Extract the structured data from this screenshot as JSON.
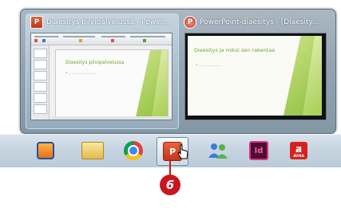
{
  "thumbnails": [
    {
      "title": "Diaesitys pilvipalvelussa - Power...",
      "icon": "powerpoint-icon",
      "slide_title": "Diaesitys pilvipalvelussa",
      "active": true
    },
    {
      "title": "PowerPoint-diaesitys - [Diaesity...",
      "icon": "powerpoint-web-icon",
      "slide_title": "Diaesitys ja miksi sen rakentaa",
      "active": false
    }
  ],
  "taskbar": {
    "items": [
      {
        "name": "media-player",
        "icon": "media-player-icon"
      },
      {
        "name": "file-explorer",
        "icon": "folder-icon"
      },
      {
        "name": "chrome",
        "icon": "chrome-icon"
      },
      {
        "name": "powerpoint",
        "icon": "powerpoint-icon",
        "glyph": "P"
      },
      {
        "name": "people",
        "icon": "people-icon"
      },
      {
        "name": "indesign",
        "icon": "indesign-icon",
        "glyph": "Id"
      },
      {
        "name": "avira",
        "icon": "avira-icon",
        "glyph": "AVIRA"
      }
    ]
  },
  "callout": {
    "number": "6"
  },
  "colors": {
    "callout": "#c7161f",
    "accent_green": "#8cbf3c"
  }
}
